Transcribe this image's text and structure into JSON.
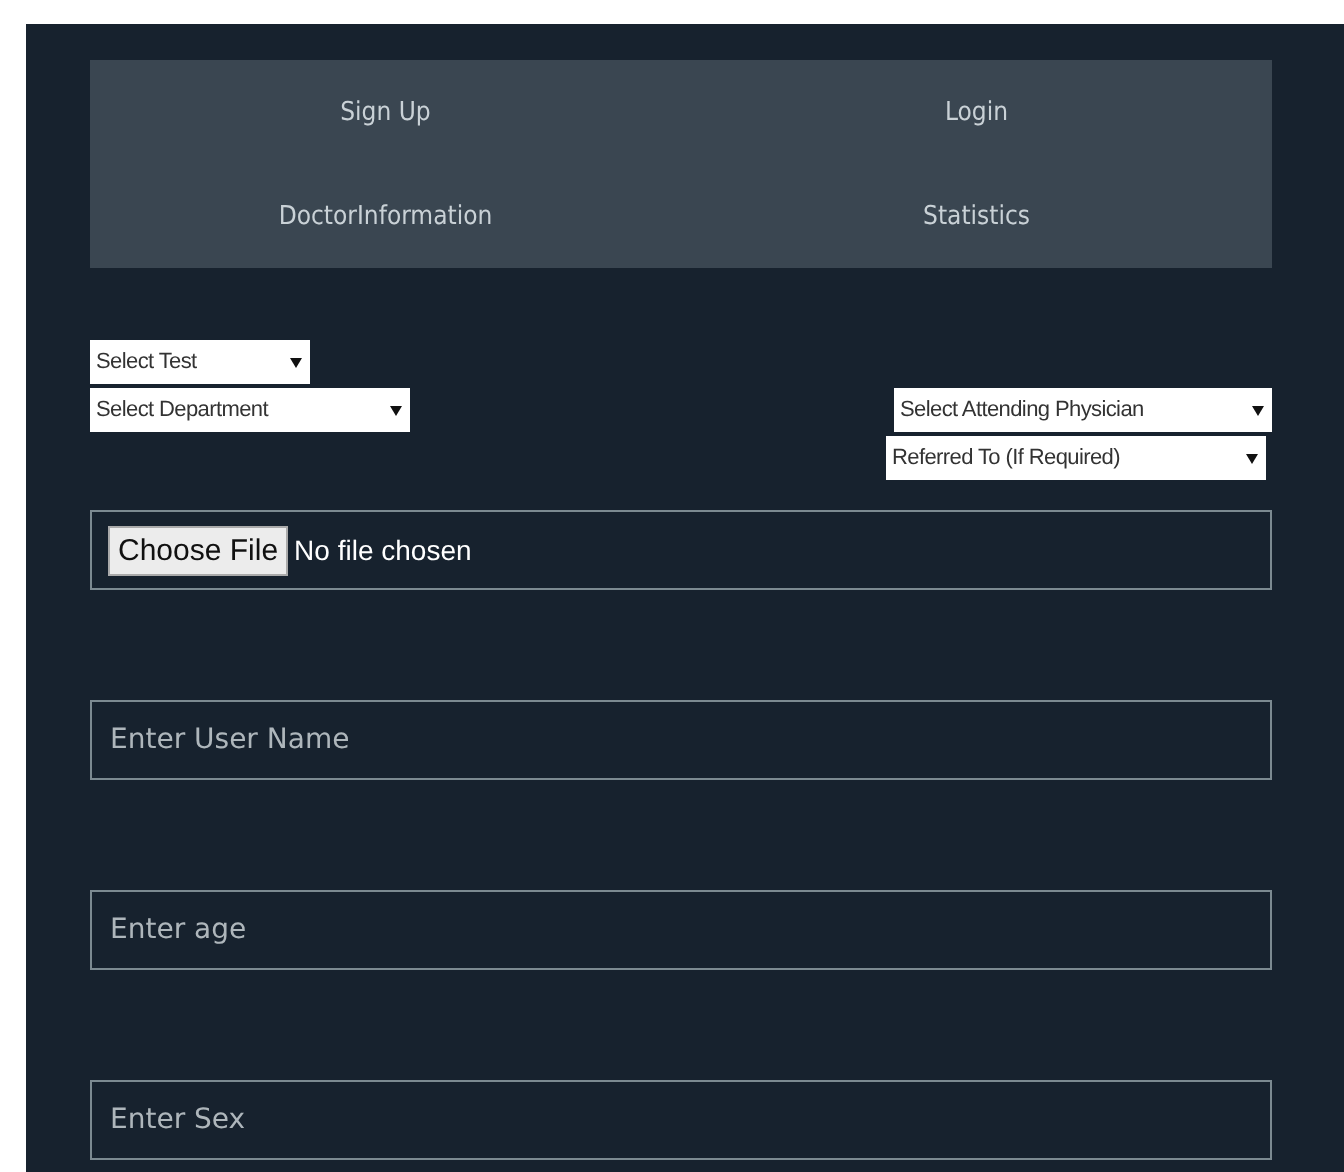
{
  "nav": [
    {
      "label": "Sign Up"
    },
    {
      "label": "Login"
    },
    {
      "label": "DoctorInformation"
    },
    {
      "label": "Statistics"
    }
  ],
  "selects_left": [
    {
      "label": "Select Test"
    },
    {
      "label": "Select Department"
    }
  ],
  "selects_right": [
    {
      "label": "Select Attending Physician"
    },
    {
      "label": "Referred To (If Required)"
    }
  ],
  "file_input": {
    "button": "Choose File",
    "status": "No file chosen"
  },
  "fields": [
    {
      "placeholder": "Enter User Name"
    },
    {
      "placeholder": "Enter age"
    },
    {
      "placeholder": "Enter Sex"
    }
  ]
}
